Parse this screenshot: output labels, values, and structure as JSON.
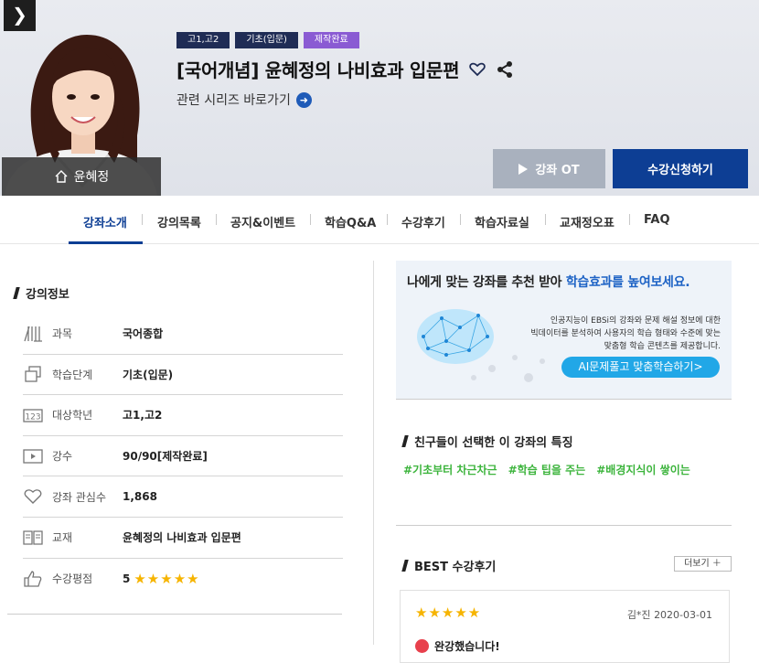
{
  "nav": {
    "toggle_glyph": "❯"
  },
  "teacher": {
    "name": "윤혜정"
  },
  "course": {
    "badges": [
      "고1,고2",
      "기초(입문)",
      "제작완료"
    ],
    "title": "[국어개념] 윤혜정의 나비효과 입문편",
    "series_link": "관련 시리즈 바로가기",
    "series_arrow": "➜"
  },
  "actions": {
    "ot_label": "강좌 OT",
    "enroll_label": "수강신청하기"
  },
  "tabs": [
    "강좌소개",
    "강의목록",
    "공지&이벤트",
    "학습Q&A",
    "수강후기",
    "학습자료실",
    "교재정오표",
    "FAQ"
  ],
  "info": {
    "heading": "강의정보",
    "rows": [
      {
        "icon": "books-icon",
        "label": "과목",
        "value": "국어종합"
      },
      {
        "icon": "stage-icon",
        "label": "학습단계",
        "value": "기초(입문)"
      },
      {
        "icon": "grade-123-icon",
        "label": "대상학년",
        "value": "고1,고2"
      },
      {
        "icon": "play-icon",
        "label": "강수",
        "value": "90/90[제작완료]"
      },
      {
        "icon": "heart-icon",
        "label": "강좌 관심수",
        "value": "1,868"
      },
      {
        "icon": "textbook-icon",
        "label": "교재",
        "value": "윤혜정의 나비효과 입문편"
      },
      {
        "icon": "thumbs-up-icon",
        "label": "수강평점",
        "value": "5",
        "stars": "★★★★★"
      }
    ]
  },
  "ai_card": {
    "head_plain": "나에게 맞는 강좌를 추천 받아 ",
    "head_highlight": "학습효과를 높여보세요.",
    "desc": [
      "인공지능이 EBSi의 강좌와 문제 해설 정보에 대한",
      "빅데이터를 분석하여 사용자의 학습 형태와 수준에 맞는",
      "맞춤형 학습 콘텐츠를 제공합니다."
    ],
    "button": "AI문제풀고 맞춤학습하기>"
  },
  "features": {
    "heading": "친구들이 선택한 이 강좌의 특징",
    "hashtags": [
      "#기초부터 차근차근",
      "#학습 팁을 주는",
      "#배경지식이 쌓이는"
    ]
  },
  "reviews": {
    "heading": "BEST 수강후기",
    "more": "더보기 ＋",
    "items": [
      {
        "stars": "★★★★★",
        "author": "김*진",
        "date": "2020-03-01",
        "title": "완강했습니다!"
      }
    ]
  },
  "colors": {
    "brand": "#0d3e94",
    "accent": "#1e63c5",
    "hashtag": "#3cb43c",
    "star": "#f6b400"
  }
}
